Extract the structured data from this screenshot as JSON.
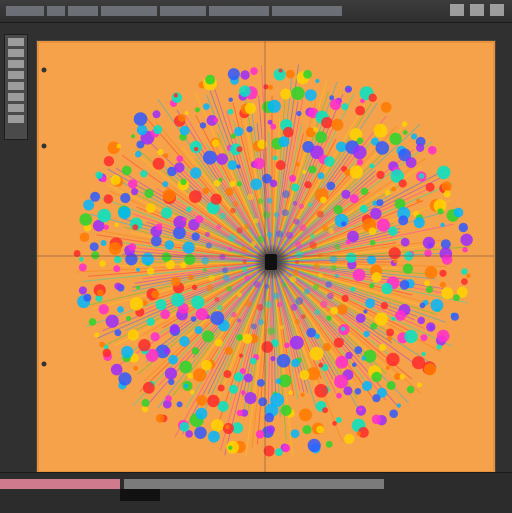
{
  "window": {
    "title": "",
    "menu_visible": true
  },
  "toolbar": {
    "tools": [
      "tool-1",
      "tool-2",
      "tool-3",
      "tool-4",
      "tool-5",
      "tool-6",
      "tool-7",
      "tool-8"
    ]
  },
  "canvas": {
    "background": "#f6a24a",
    "center": "#121212",
    "palette": [
      "#ff2a2a",
      "#ff7a00",
      "#ffd400",
      "#29d62b",
      "#00b7ff",
      "#2f5bff",
      "#9a2cff",
      "#ff2bd1",
      "#00e5c5"
    ],
    "rings": 10
  },
  "status": {
    "text": ""
  }
}
